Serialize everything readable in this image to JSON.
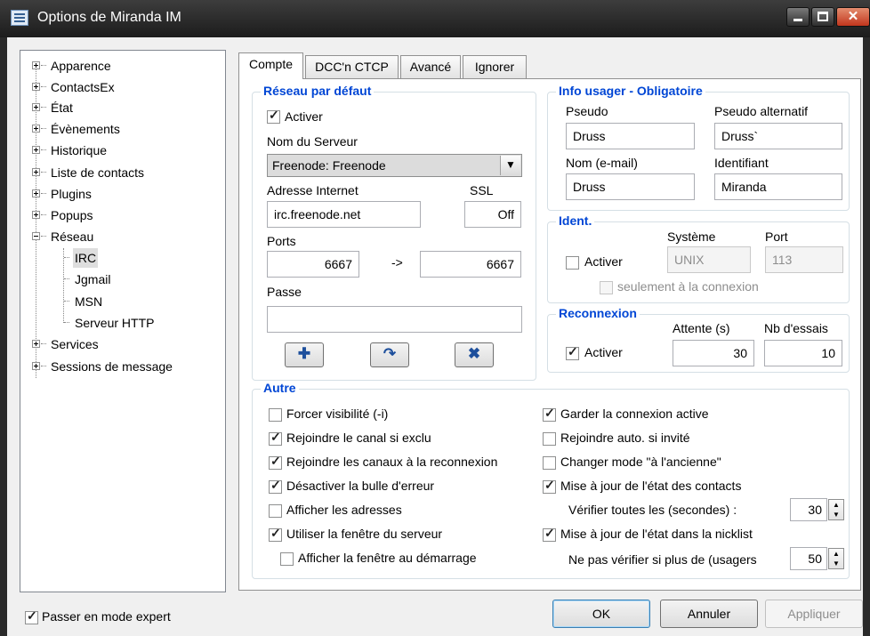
{
  "window": {
    "title": "Options de Miranda IM"
  },
  "tree": {
    "items": [
      {
        "label": "Apparence"
      },
      {
        "label": "ContactsEx"
      },
      {
        "label": "État"
      },
      {
        "label": "Évènements"
      },
      {
        "label": "Historique"
      },
      {
        "label": "Liste de contacts"
      },
      {
        "label": "Plugins"
      },
      {
        "label": "Popups"
      },
      {
        "label": "Réseau"
      },
      {
        "label": "IRC"
      },
      {
        "label": "Jgmail"
      },
      {
        "label": "MSN"
      },
      {
        "label": "Serveur HTTP"
      },
      {
        "label": "Services"
      },
      {
        "label": "Sessions de message"
      }
    ]
  },
  "tabs": [
    "Compte",
    "DCC'n CTCP",
    "Avancé",
    "Ignorer"
  ],
  "reseau": {
    "title": "Réseau par défaut",
    "activer_label": "Activer",
    "activer_checked": true,
    "server_label": "Nom du Serveur",
    "server_value": "Freenode: Freenode",
    "address_label": "Adresse Internet",
    "address_value": "irc.freenode.net",
    "ssl_label": "SSL",
    "ssl_value": "Off",
    "ports_label": "Ports",
    "port_from": "6667",
    "port_arrow": "->",
    "port_to": "6667",
    "passe_label": "Passe",
    "passe_value": ""
  },
  "info": {
    "title": "Info usager - Obligatoire",
    "pseudo_label": "Pseudo",
    "pseudo_value": "Druss",
    "alt_label": "Pseudo alternatif",
    "alt_value": "Druss`",
    "nom_label": "Nom (e-mail)",
    "nom_value": "Druss",
    "ident_label": "Identifiant",
    "ident_value": "Miranda"
  },
  "ident": {
    "title": "Ident.",
    "activer_label": "Activer",
    "activer_checked": false,
    "systeme_label": "Système",
    "systeme_value": "UNIX",
    "port_label": "Port",
    "port_value": "113",
    "seulement_label": "seulement à la connexion"
  },
  "reconnexion": {
    "title": "Reconnexion",
    "activer_label": "Activer",
    "activer_checked": true,
    "attente_label": "Attente (s)",
    "attente_value": "30",
    "essais_label": "Nb d'essais",
    "essais_value": "10"
  },
  "autre": {
    "title": "Autre",
    "left": [
      {
        "label": "Forcer visibilité (-i)",
        "checked": false
      },
      {
        "label": "Rejoindre le canal si exclu",
        "checked": true
      },
      {
        "label": "Rejoindre les canaux à la reconnexion",
        "checked": true
      },
      {
        "label": "Désactiver la bulle d'erreur",
        "checked": true
      },
      {
        "label": "Afficher les adresses",
        "checked": false
      },
      {
        "label": "Utiliser la fenêtre du serveur",
        "checked": true
      },
      {
        "label": "Afficher la fenêtre au démarrage",
        "checked": false
      }
    ],
    "right": [
      {
        "label": "Garder la connexion active",
        "checked": true
      },
      {
        "label": "Rejoindre auto. si invité",
        "checked": false
      },
      {
        "label": "Changer mode \"à l'ancienne\"",
        "checked": false
      },
      {
        "label": "Mise à jour de l'état des contacts",
        "checked": true
      },
      {
        "label": "Mise à jour de l'état dans la nicklist",
        "checked": true
      }
    ],
    "verifier_label": "Vérifier toutes les (secondes) :",
    "verifier_value": "30",
    "nepas_label": "Ne pas vérifier si plus de (usagers",
    "nepas_value": "50"
  },
  "footer": {
    "expert_label": "Passer en mode expert",
    "expert_checked": true,
    "ok_label": "OK",
    "cancel_label": "Annuler",
    "apply_label": "Appliquer"
  }
}
